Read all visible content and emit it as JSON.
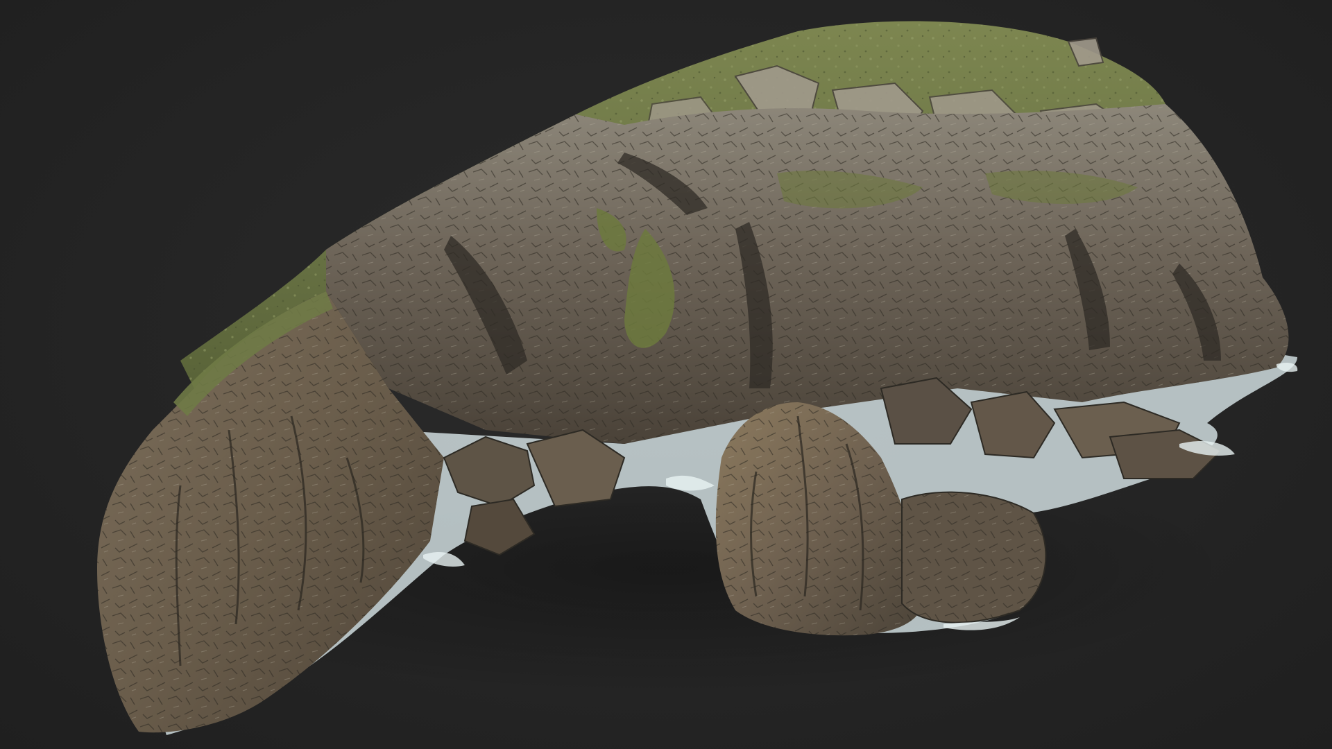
{
  "scene": {
    "subject": "rock-island-3d-scan",
    "colors": {
      "background": "#262626",
      "grass": "#6f7a46",
      "grass_dark": "#55603a",
      "rock_light": "#9a9486",
      "rock_mid": "#6e655a",
      "rock_dark": "#3e3a33",
      "rock_warm": "#8a6f4f",
      "foam": "#d6e4e6"
    }
  }
}
